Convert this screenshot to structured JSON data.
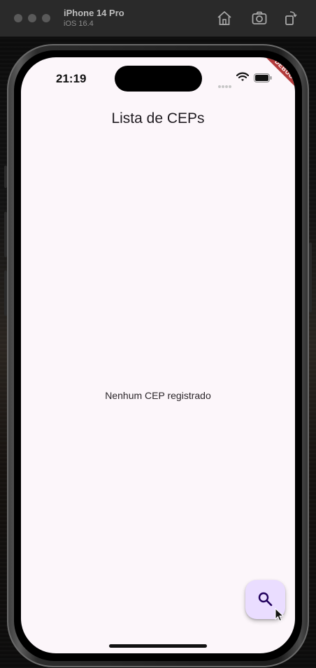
{
  "simulator": {
    "device_name": "iPhone 14 Pro",
    "os_version": "iOS 16.4",
    "buttons": {
      "home_icon": "home-icon",
      "screenshot_icon": "camera-icon",
      "rotate_icon": "rotate-icon"
    }
  },
  "status_bar": {
    "time": "21:19",
    "wifi_icon": "wifi-icon",
    "battery_icon": "battery-icon"
  },
  "debug_banner": "DEBUG",
  "app": {
    "title": "Lista de CEPs",
    "empty_message": "Nenhum CEP registrado",
    "fab_icon": "search-icon"
  },
  "colors": {
    "screen_background": "#fcf6fa",
    "fab_background": "#eaddff",
    "debug_ribbon": "#b33a3a"
  }
}
